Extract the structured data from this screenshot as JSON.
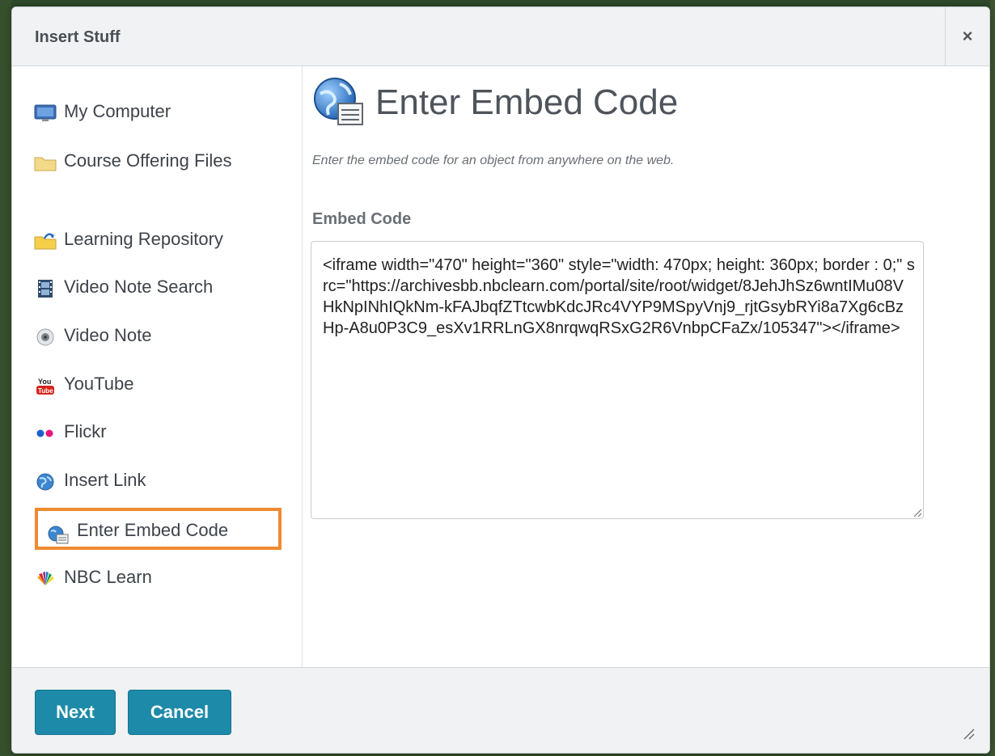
{
  "dialog": {
    "title": "Insert Stuff",
    "close_label": "×"
  },
  "sidebar": {
    "items": [
      {
        "label": "My Computer",
        "icon": "monitor-icon"
      },
      {
        "label": "Course Offering Files",
        "icon": "folder-icon"
      },
      {
        "label": "Learning Repository",
        "icon": "repository-folder-icon"
      },
      {
        "label": "Video Note Search",
        "icon": "film-icon"
      },
      {
        "label": "Video Note",
        "icon": "webcam-icon"
      },
      {
        "label": "YouTube",
        "icon": "youtube-icon"
      },
      {
        "label": "Flickr",
        "icon": "flickr-icon"
      },
      {
        "label": "Insert Link",
        "icon": "globe-icon"
      },
      {
        "label": "Enter Embed Code",
        "icon": "globe-document-icon",
        "selected": true
      },
      {
        "label": "NBC Learn",
        "icon": "nbc-peacock-icon"
      }
    ]
  },
  "main": {
    "heading": "Enter Embed Code",
    "description": "Enter the embed code for an object from anywhere on the web.",
    "field_label": "Embed Code",
    "embed_code": "<iframe width=\"470\" height=\"360\" style=\"width: 470px; height: 360px; border : 0;\" src=\"https://archivesbb.nbclearn.com/portal/site/root/widget/8JehJhSz6wntIMu08VHkNpINhIQkNm-kFAJbqfZTtcwbKdcJRc4VYP9MSpyVnj9_rjtGsybRYi8a7Xg6cBzHp-A8u0P3C9_esXv1RRLnGX8nrqwqRSxG2R6VnbpCFaZx/105347\"></iframe>"
  },
  "footer": {
    "next_label": "Next",
    "cancel_label": "Cancel"
  },
  "colors": {
    "accent_button": "#1e8aa9",
    "selection_outline": "#f08a32"
  }
}
